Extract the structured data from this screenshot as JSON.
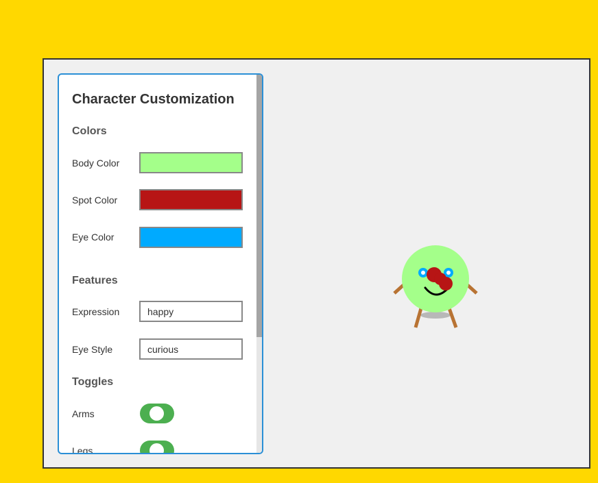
{
  "panel": {
    "title": "Character Customization",
    "sections": {
      "colors": "Colors",
      "features": "Features",
      "toggles": "Toggles"
    },
    "colors": [
      {
        "label": "Body Color",
        "value": "#a4ff8a"
      },
      {
        "label": "Spot Color",
        "value": "#b71515"
      },
      {
        "label": "Eye Color",
        "value": "#00aaff"
      }
    ],
    "features": [
      {
        "label": "Expression",
        "value": "happy"
      },
      {
        "label": "Eye Style",
        "value": "curious"
      }
    ],
    "toggles": [
      {
        "label": "Arms",
        "on": true
      },
      {
        "label": "Legs",
        "on": true
      }
    ]
  },
  "character": {
    "body_color": "#a4ff8a",
    "spot_color": "#b71515",
    "eye_color": "#00aaff",
    "limb_color": "#b87333",
    "shadow_color": "#b8b8b8"
  }
}
